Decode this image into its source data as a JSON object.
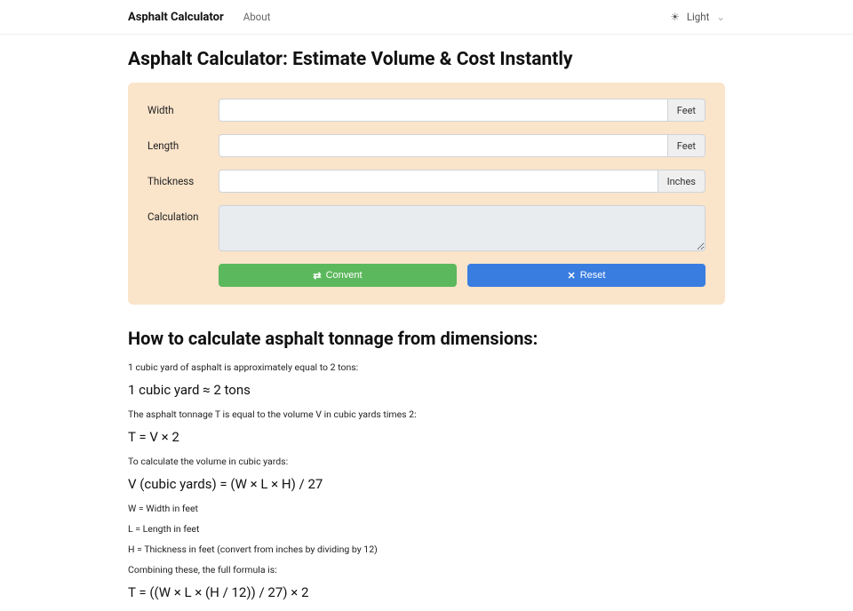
{
  "nav": {
    "brand": "Asphalt Calculator",
    "about": "About",
    "theme_label": "Light"
  },
  "page": {
    "title": "Asphalt Calculator: Estimate Volume & Cost Instantly"
  },
  "form": {
    "width_label": "Width",
    "width_unit": "Feet",
    "length_label": "Length",
    "length_unit": "Feet",
    "thickness_label": "Thickness",
    "thickness_unit": "Inches",
    "calc_label": "Calculation",
    "convert_btn": "Convent",
    "reset_btn": "Reset"
  },
  "howto": {
    "heading": "How to calculate asphalt tonnage from dimensions:",
    "p1": "1 cubic yard of asphalt is approximately equal to 2 tons:",
    "f1": "1 cubic yard ≈ 2 tons",
    "p2": "The asphalt tonnage T is equal to the volume V in cubic yards times 2:",
    "f2": "T = V × 2",
    "p3": "To calculate the volume in cubic yards:",
    "f3": "V (cubic yards) = (W × L × H) / 27",
    "p4": "W = Width in feet",
    "p5": "L = Length in feet",
    "p6": "H = Thickness in feet (convert from inches by dividing by 12)",
    "p7": "Combining these, the full formula is:",
    "f4": "T = ((W × L × (H / 12)) / 27) × 2"
  }
}
